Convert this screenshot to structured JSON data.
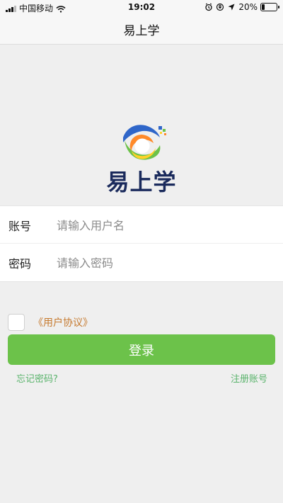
{
  "status": {
    "carrier": "中国移动",
    "time": "19:02",
    "battery_percent": "20%",
    "battery_level": 0.2
  },
  "navbar": {
    "title": "易上学"
  },
  "logo": {
    "text": "易上学",
    "colors": {
      "primary": "#1a2a5c",
      "blue": "#2f66c9",
      "green": "#6cc24a",
      "orange": "#ff8a2a",
      "yellow": "#ffd128"
    }
  },
  "form": {
    "account_label": "账号",
    "account_placeholder": "请输入用户名",
    "password_label": "密码",
    "password_placeholder": "请输入密码"
  },
  "agreement": {
    "text": "《用户协议》",
    "checked": false
  },
  "actions": {
    "login_label": "登录",
    "forgot_label": "忘记密码?",
    "register_label": "注册账号"
  }
}
